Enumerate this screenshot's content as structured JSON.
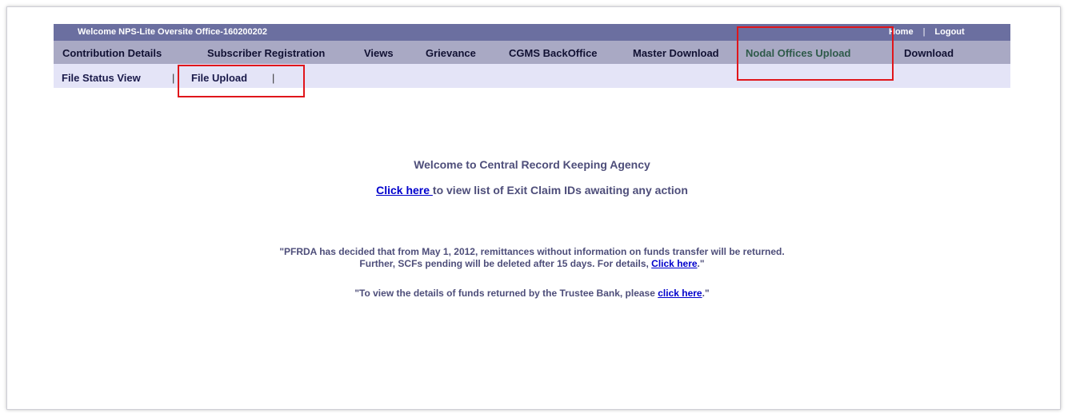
{
  "header": {
    "welcome_text": "Welcome NPS-Lite Oversite Office-160200202",
    "home_label": "Home",
    "separator": "|",
    "logout_label": "Logout"
  },
  "main_menu": {
    "items": [
      {
        "label": "Contribution Details"
      },
      {
        "label": "Subscriber Registration"
      },
      {
        "label": "Views"
      },
      {
        "label": "Grievance"
      },
      {
        "label": "CGMS BackOffice"
      },
      {
        "label": "Master Download"
      },
      {
        "label": "Nodal Offices Upload"
      },
      {
        "label": "Download"
      }
    ],
    "active": "Nodal Offices Upload"
  },
  "sub_menu": {
    "items": [
      {
        "label": "File Status View"
      },
      {
        "label": "File Upload"
      }
    ],
    "separator": "|"
  },
  "content": {
    "heading": "Welcome to Central Record Keeping Agency",
    "claim_link": "Click here ",
    "claim_text": "to view list of Exit Claim IDs awaiting any action",
    "notice1_line1": "\"PFRDA has decided that from May 1, 2012, remittances without information on funds transfer will be returned.",
    "notice1_line2_prefix": "Further, SCFs pending will be deleted after 15 days. For details, ",
    "notice1_link": "Click here",
    "notice1_suffix": ".\"",
    "notice2_prefix": "\"To view the details of funds returned by the Trustee Bank, please ",
    "notice2_link": "click here",
    "notice2_suffix": ".\""
  },
  "colors": {
    "top_bar": "#6b6fa0",
    "main_menu": "#a9a9c4",
    "sub_menu": "#e4e4f7",
    "highlight": "#e0161b",
    "link": "#0000cc"
  }
}
